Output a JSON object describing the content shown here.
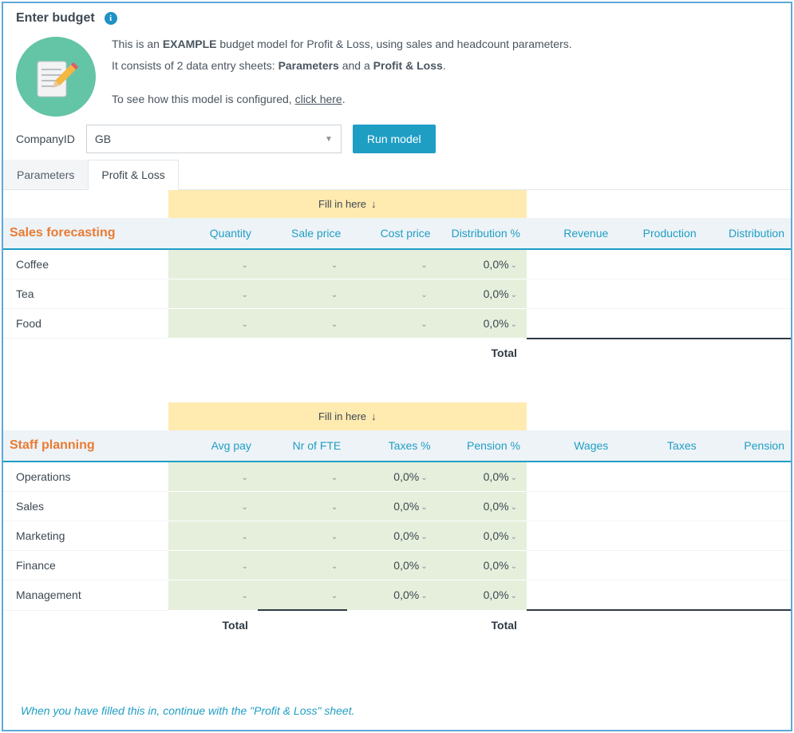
{
  "header": {
    "title": "Enter budget",
    "info_icon": "i",
    "intro_line1_pre": "This is an ",
    "intro_line1_bold": "EXAMPLE",
    "intro_line1_post": " budget model for Profit & Loss, using sales and headcount parameters.",
    "intro_line2_pre": "It consists of 2 data entry sheets: ",
    "intro_line2_b1": "Parameters",
    "intro_line2_mid": " and a ",
    "intro_line2_b2": "Profit & Loss",
    "intro_line2_post": ".",
    "intro_line3_pre": "To see how this model is configured, ",
    "intro_line3_link": "click here",
    "intro_line3_post": "."
  },
  "controls": {
    "company_label": "CompanyID",
    "company_value": "GB",
    "run_button": "Run model"
  },
  "tabs": {
    "parameters": "Parameters",
    "profit_loss": "Profit & Loss"
  },
  "fill_hint": "Fill in here",
  "sales": {
    "title": "Sales forecasting",
    "cols": {
      "quantity": "Quantity",
      "sale_price": "Sale price",
      "cost_price": "Cost price",
      "dist_pct": "Distribution %",
      "revenue": "Revenue",
      "production": "Production",
      "distribution": "Distribution"
    },
    "rows": [
      {
        "label": "Coffee",
        "quantity": "",
        "sale_price": "",
        "cost_price": "",
        "dist_pct": "0,0%"
      },
      {
        "label": "Tea",
        "quantity": "",
        "sale_price": "",
        "cost_price": "",
        "dist_pct": "0,0%"
      },
      {
        "label": "Food",
        "quantity": "",
        "sale_price": "",
        "cost_price": "",
        "dist_pct": "0,0%"
      }
    ],
    "total_label": "Total"
  },
  "staff": {
    "title": "Staff planning",
    "cols": {
      "avg_pay": "Avg pay",
      "nr_fte": "Nr of FTE",
      "taxes_pct": "Taxes %",
      "pension_pct": "Pension %",
      "wages": "Wages",
      "taxes": "Taxes",
      "pension": "Pension"
    },
    "rows": [
      {
        "label": "Operations",
        "avg_pay": "",
        "nr_fte": "",
        "taxes_pct": "0,0%",
        "pension_pct": "0,0%"
      },
      {
        "label": "Sales",
        "avg_pay": "",
        "nr_fte": "",
        "taxes_pct": "0,0%",
        "pension_pct": "0,0%"
      },
      {
        "label": "Marketing",
        "avg_pay": "",
        "nr_fte": "",
        "taxes_pct": "0,0%",
        "pension_pct": "0,0%"
      },
      {
        "label": "Finance",
        "avg_pay": "",
        "nr_fte": "",
        "taxes_pct": "0,0%",
        "pension_pct": "0,0%"
      },
      {
        "label": "Management",
        "avg_pay": "",
        "nr_fte": "",
        "taxes_pct": "0,0%",
        "pension_pct": "0,0%"
      }
    ],
    "total_label_left": "Total",
    "total_label_right": "Total"
  },
  "footer_note": "When you have filled this in, continue with the \"Profit & Loss\" sheet."
}
